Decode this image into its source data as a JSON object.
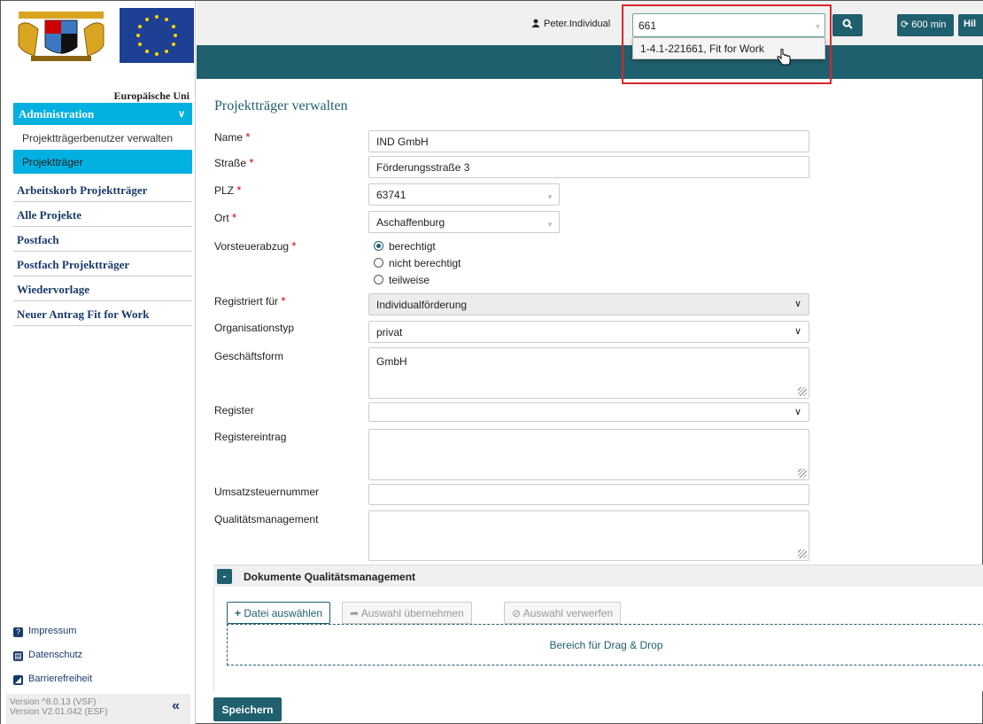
{
  "sidebar": {
    "eu_label": "Europäische Uni",
    "admin_header": "Administration",
    "sub_items": [
      {
        "label": "Projektträgerbenutzer verwalten"
      },
      {
        "label": "Projektträger"
      }
    ],
    "main_items": [
      {
        "label": "Arbeitskorb Projektträger"
      },
      {
        "label": "Alle Projekte"
      },
      {
        "label": "Postfach"
      },
      {
        "label": "Postfach Projektträger"
      },
      {
        "label": "Wiedervorlage"
      },
      {
        "label": "Neuer Antrag Fit for Work"
      }
    ],
    "footer_links": [
      {
        "label": "Impressum",
        "icon": "question-icon"
      },
      {
        "label": "Datenschutz",
        "icon": "document-icon"
      },
      {
        "label": "Barrierefreiheit",
        "icon": "accessibility-icon"
      }
    ],
    "version_line1": "Version ^8.0.13 (VSF)",
    "version_line2": "Version V2.01.042 (ESF)"
  },
  "topbar": {
    "user_name": "Peter.Individual",
    "search_value": "661",
    "suggestion": "1-4.1-221661, Fit for Work",
    "timer_label": "600 min",
    "help_label": "Hil"
  },
  "form": {
    "title": "Projektträger verwalten",
    "name_label": "Name",
    "name_value": "IND GmbH",
    "street_label": "Straße",
    "street_value": "Förderungsstraße 3",
    "plz_label": "PLZ",
    "plz_value": "63741",
    "city_label": "Ort",
    "city_value": "Aschaffenburg",
    "vat_label": "Vorsteuerabzug",
    "vat_options": [
      "berechtigt",
      "nicht berechtigt",
      "teilweise"
    ],
    "registered_label": "Registriert für",
    "registered_value": "Individualförderung",
    "orgtype_label": "Organisationstyp",
    "orgtype_value": "privat",
    "bizform_label": "Geschäftsform",
    "bizform_value": "GmbH",
    "register_label": "Register",
    "register_value": "",
    "register_entry_label": "Registereintrag",
    "tax_number_label": "Umsatzsteuernummer",
    "quality_label": "Qualitätsmanagement"
  },
  "docs": {
    "toggle": "-",
    "title": "Dokumente Qualitätsmanagement",
    "choose_file": "Datei auswählen",
    "apply_selection": "Auswahl übernehmen",
    "discard_selection": "Auswahl verwerfen",
    "dropzone": "Bereich für Drag & Drop"
  },
  "save_label": "Speichern",
  "colors": {
    "accent": "#00b0e0",
    "primary": "#1f5f6e",
    "highlight": "#d8262b"
  }
}
